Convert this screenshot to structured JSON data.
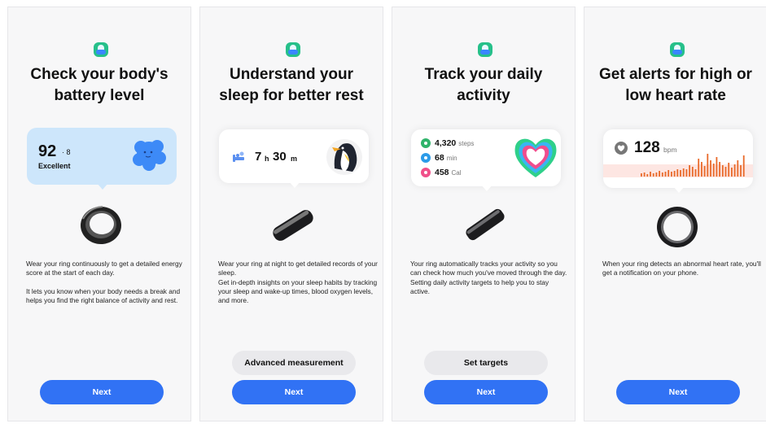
{
  "screens": [
    {
      "title": "Check your body's\nbattery level",
      "card": {
        "score": "92",
        "delta": "· 8",
        "label": "Excellent"
      },
      "body": "Wear your ring continuously to get a detailed energy score at the start of each day.\n\nIt lets you know when your body needs a break and helps you find the right balance of activity and rest.",
      "next_label": "Next"
    },
    {
      "title": "Understand your\nsleep for better rest",
      "card": {
        "hours": "7",
        "hours_unit": "h",
        "minutes": "30",
        "minutes_unit": "m"
      },
      "body": "Wear your ring at night to get detailed records of your sleep.\nGet in-depth insights on your sleep habits by tracking your sleep and wake-up times, blood oxygen levels, and more.",
      "secondary_label": "Advanced measurement",
      "next_label": "Next"
    },
    {
      "title": "Track your daily\nactivity",
      "card": {
        "stats": [
          {
            "value": "4,320",
            "unit": "steps",
            "color": "#2fb36a"
          },
          {
            "value": "68",
            "unit": "min",
            "color": "#2c9be8"
          },
          {
            "value": "458",
            "unit": "Cal",
            "color": "#f0508a"
          }
        ]
      },
      "body": "Your ring automatically tracks your activity so you can check how much you've moved through the day.\nSetting daily activity targets to help you to stay active.",
      "secondary_label": "Set targets",
      "next_label": "Next"
    },
    {
      "title": "Get alerts for high or\nlow heart rate",
      "card": {
        "bpm": "128",
        "bpm_unit": "bpm"
      },
      "body": "When your ring detects an abnormal heart rate, you'll get a notification on your phone.",
      "next_label": "Next"
    }
  ],
  "colors": {
    "accent": "#3172f4",
    "battery_card": "#cde6fb",
    "heart_rate_bars": "#e96a2a"
  },
  "icons": [
    "app-icon",
    "sun-cloud-icon",
    "bed-icon",
    "penguin-icon",
    "activity-heart-icon",
    "heart-icon"
  ]
}
